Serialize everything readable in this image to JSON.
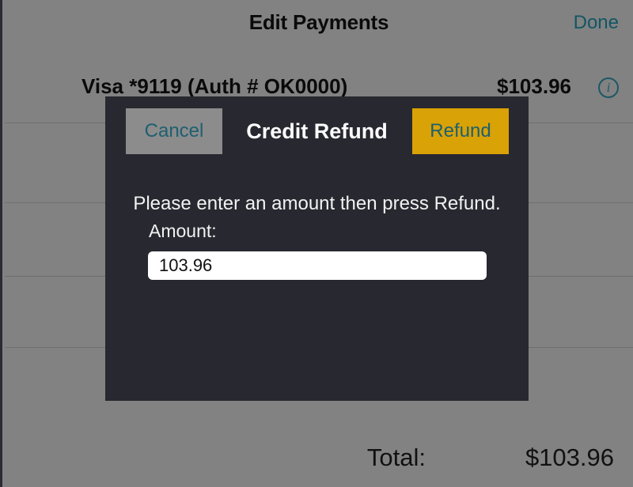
{
  "nav": {
    "title": "Edit Payments",
    "done_label": "Done"
  },
  "payments": [
    {
      "label": "Visa *9119 (Auth # OK0000)",
      "amount": "$103.96",
      "info_icon": "info-circle-icon"
    }
  ],
  "total": {
    "label": "Total:",
    "value": "$103.96"
  },
  "modal": {
    "title": "Credit Refund",
    "cancel_label": "Cancel",
    "refund_label": "Refund",
    "message": "Please enter an amount then press Refund.",
    "amount_label": "Amount:",
    "amount_value": "103.96",
    "amount_placeholder": "0.00"
  },
  "colors": {
    "screen_background": "#828282",
    "modal_background": "#282830",
    "accent_teal": "#1d6070",
    "refund_gold": "#d9a206",
    "cancel_gray": "#8c8c8c",
    "divider": "#6e6e6e"
  }
}
